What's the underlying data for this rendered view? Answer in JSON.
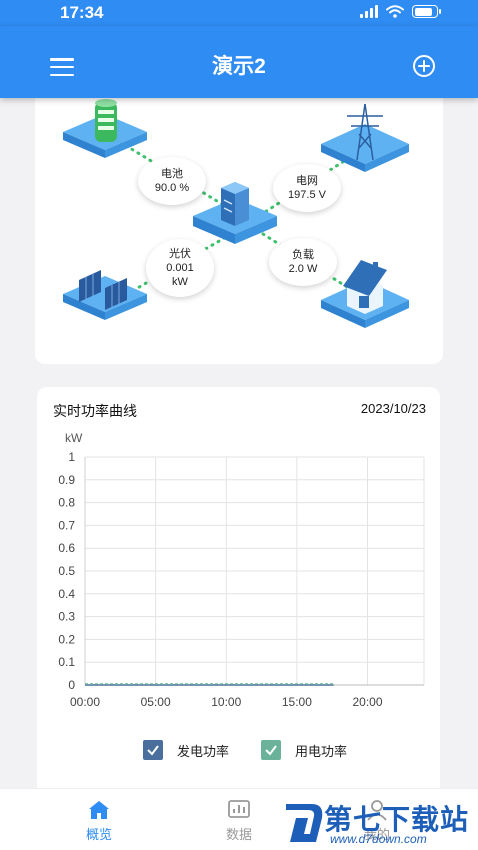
{
  "status": {
    "time": "17:34"
  },
  "app": {
    "title": "演示2"
  },
  "flow": {
    "battery": {
      "label": "电池",
      "value": "90.0 %"
    },
    "grid": {
      "label": "电网",
      "value": "197.5 V"
    },
    "solar": {
      "label": "光伏",
      "value": "0.001",
      "unit": "kW"
    },
    "load": {
      "label": "负载",
      "value": "2.0 W"
    }
  },
  "chart": {
    "title": "实时功率曲线",
    "date": "2023/10/23"
  },
  "chart_data": {
    "type": "line",
    "ylabel": "kW",
    "ylim": [
      0,
      1
    ],
    "yticks": [
      "1",
      "0.9",
      "0.8",
      "0.7",
      "0.6",
      "0.5",
      "0.4",
      "0.3",
      "0.2",
      "0.1",
      "0"
    ],
    "xticks": [
      "00:00",
      "05:00",
      "10:00",
      "15:00",
      "20:00"
    ],
    "xlim": [
      0,
      24
    ],
    "grid": true,
    "legend_position": "bottom",
    "series": [
      {
        "name": "发电功率",
        "color": "#4a6f9c",
        "x": [
          0,
          17.6
        ],
        "y": [
          0,
          0
        ]
      },
      {
        "name": "用电功率",
        "color": "#6ab39a",
        "x": [
          0,
          17.6
        ],
        "y": [
          0.002,
          0.002
        ]
      }
    ]
  },
  "legend": {
    "gen_label": "发电功率",
    "use_label": "用电功率"
  },
  "nav": {
    "overview": "概览",
    "data": "数据",
    "mine": "我的"
  },
  "watermark": {
    "text": "第七下载站",
    "url": "www.d7down.com"
  },
  "colors": {
    "primary": "#2f8cf2",
    "flow_dot": "#3dc06c",
    "gen": "#4a6f9c",
    "use": "#6ab39a"
  }
}
